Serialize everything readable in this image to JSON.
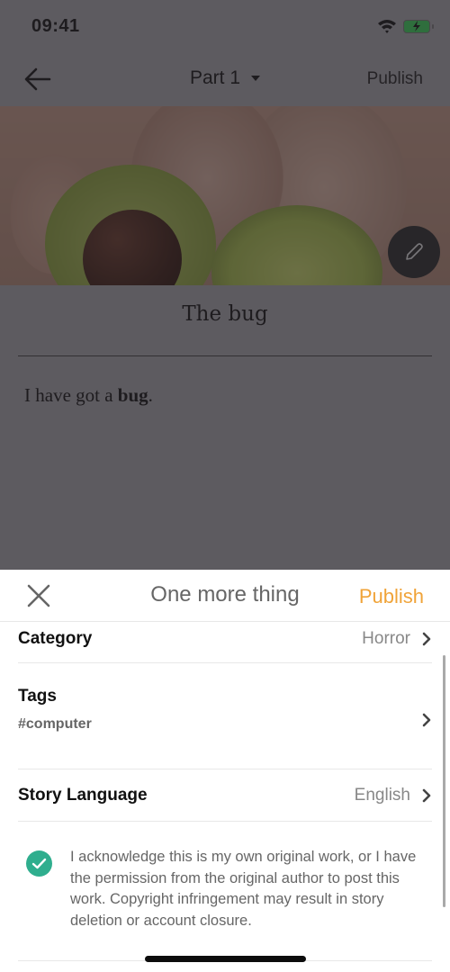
{
  "status_bar": {
    "time": "09:41",
    "wifi_icon": "wifi-icon",
    "battery_icon": "battery-charging-icon",
    "battery_color": "#3bd35a"
  },
  "nav": {
    "back_icon": "arrow-left-icon",
    "part_title": "Part 1",
    "part_caret_icon": "caret-down-icon",
    "publish_label": "Publish"
  },
  "cover": {
    "edit_icon": "pencil-icon"
  },
  "editor": {
    "story_title": "The bug",
    "body_prefix": "I have got a ",
    "body_bold": "bug",
    "body_suffix": "."
  },
  "sheet": {
    "close_icon": "close-icon",
    "title": "One more thing",
    "publish_label": "Publish",
    "publish_color": "#f0a338",
    "rows": {
      "category": {
        "label": "Category",
        "value": "Horror"
      },
      "tags": {
        "label": "Tags",
        "value": "#computer"
      },
      "language": {
        "label": "Story Language",
        "value": "English"
      }
    },
    "acknowledgement": {
      "checked": true,
      "check_color": "#2fae8e",
      "text": "I acknowledge this is my own original work, or I have the permission from the original author to post this work. Copyright infringement may result in story deletion or account closure."
    }
  }
}
